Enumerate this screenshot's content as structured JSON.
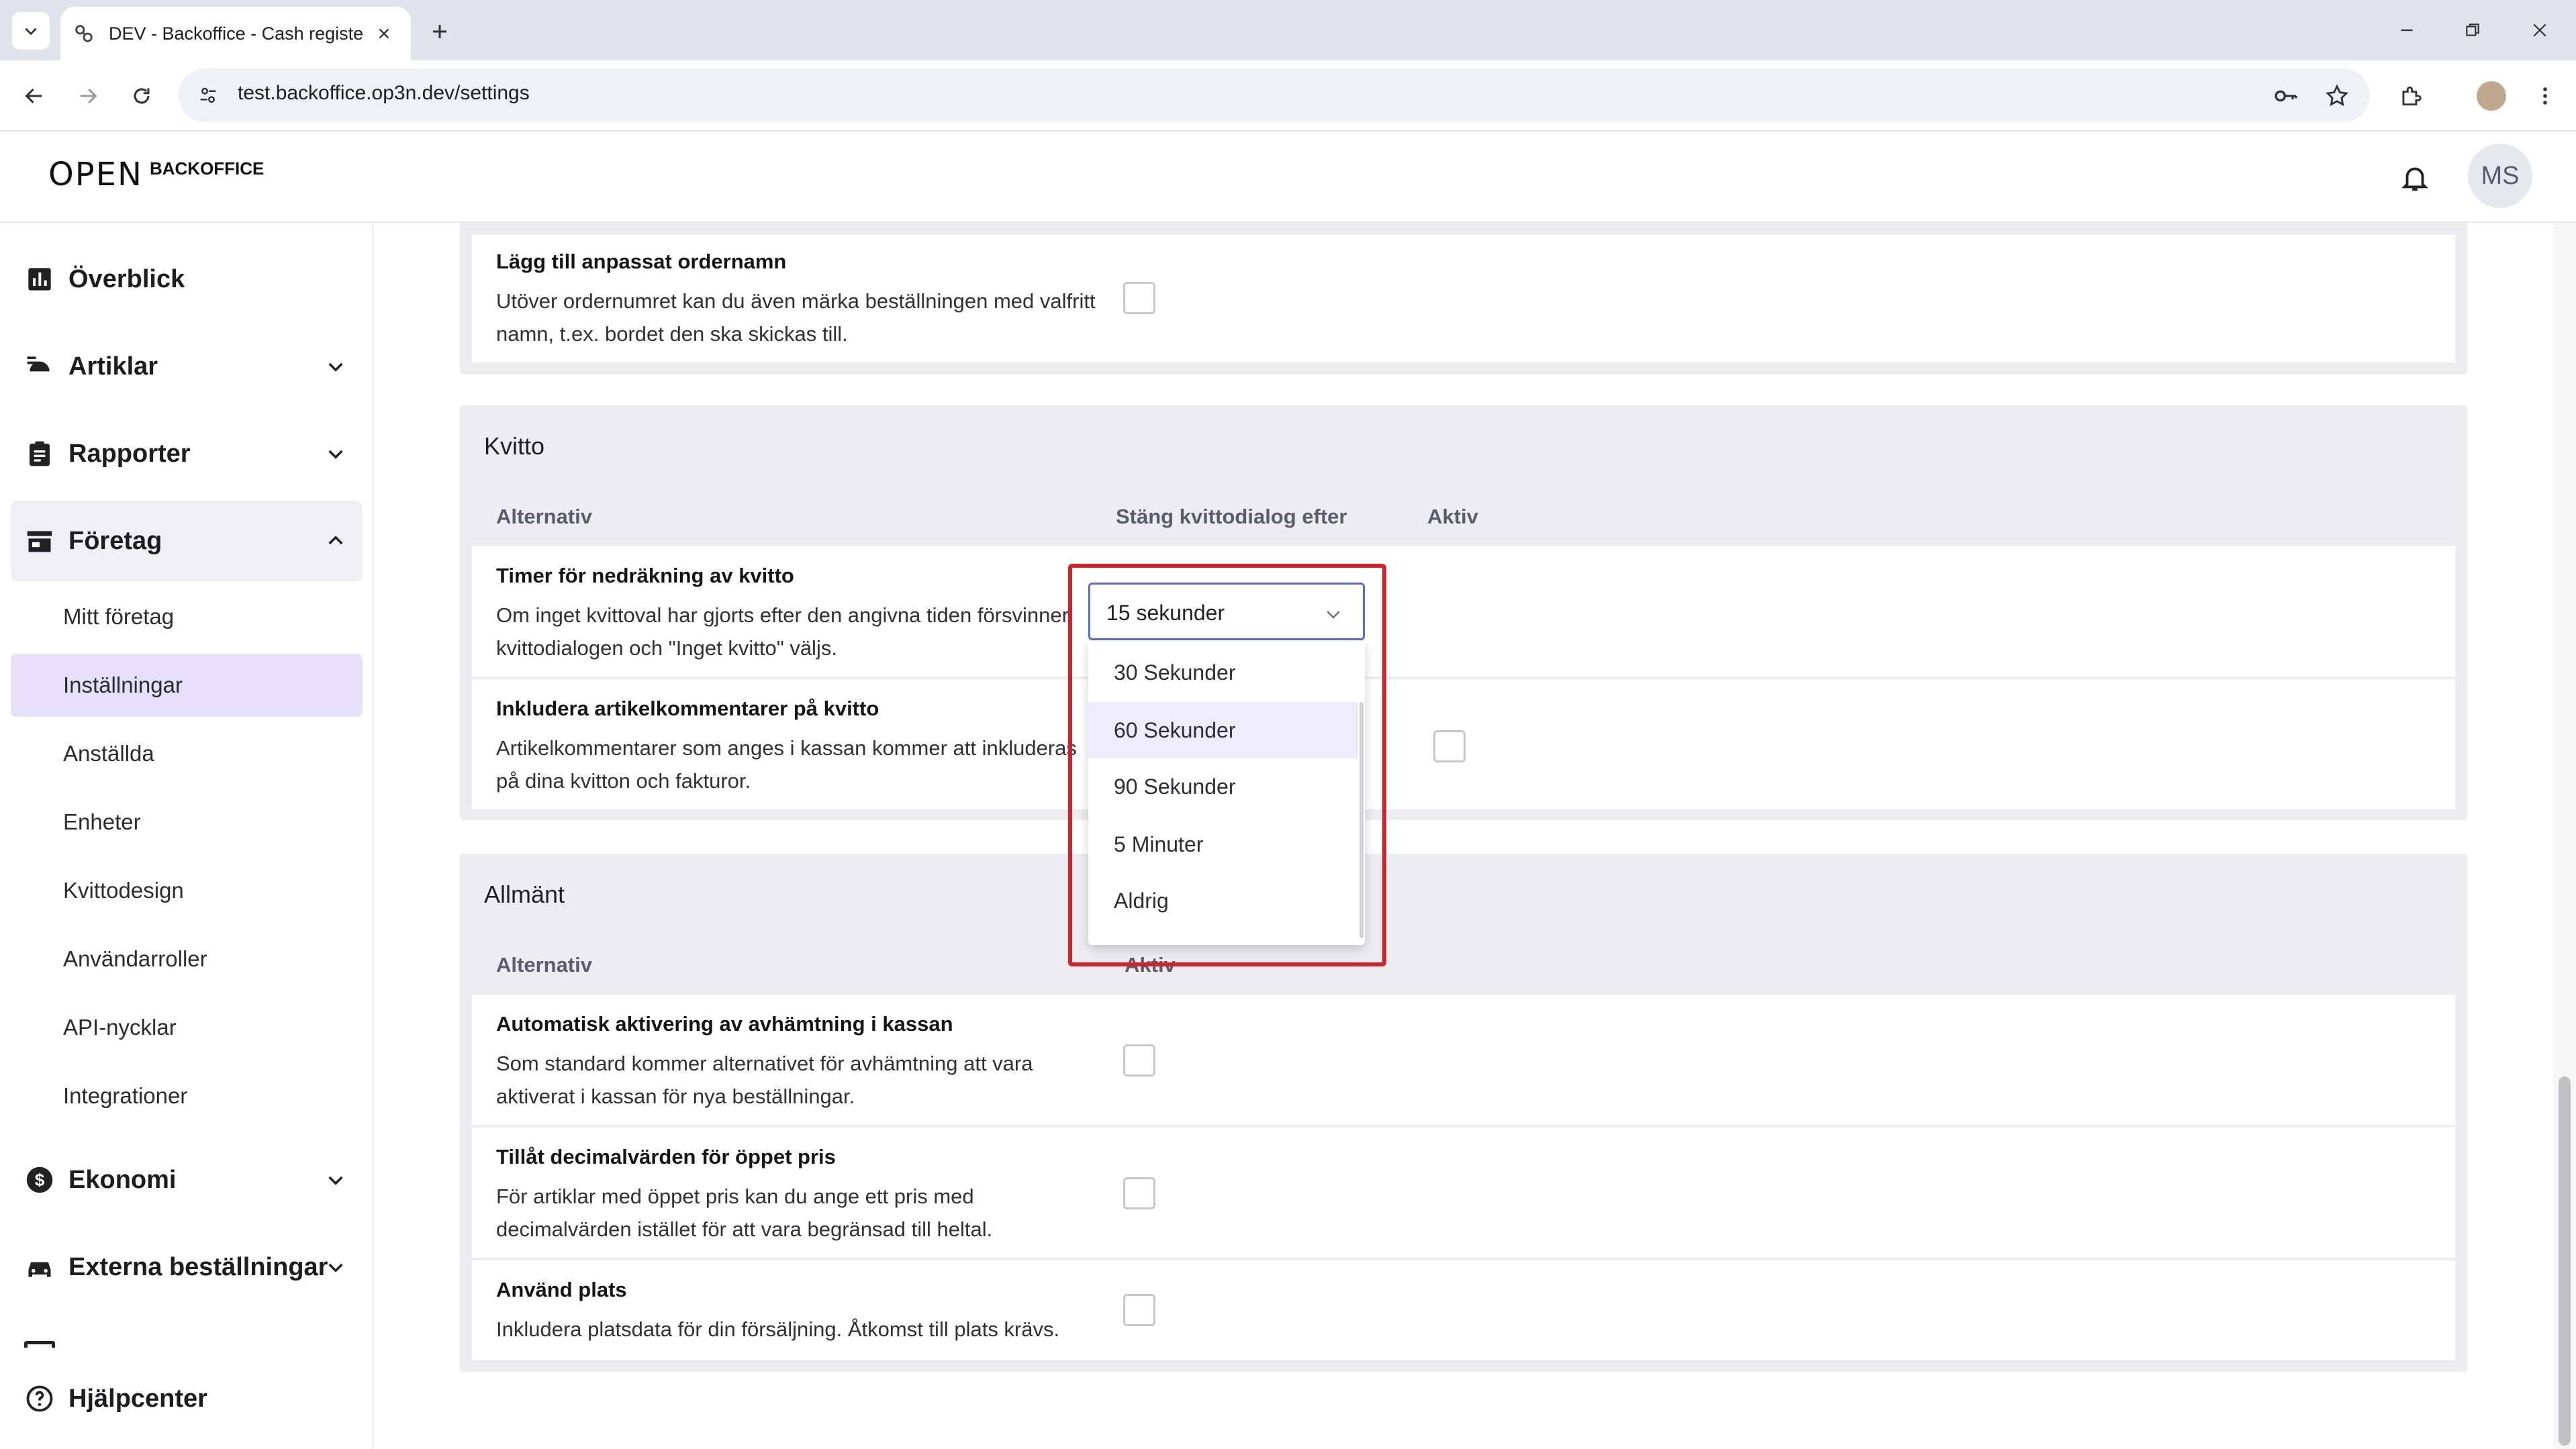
{
  "browser": {
    "tab_title": "DEV - Backoffice - Cash register",
    "url": "test.backoffice.op3n.dev/settings"
  },
  "header": {
    "logo_word": "OPEN",
    "logo_sub": "BACKOFFICE",
    "avatar_initials": "MS"
  },
  "sidebar": {
    "overview": "Överblick",
    "articles": "Artiklar",
    "reports": "Rapporter",
    "company": "Företag",
    "company_items": [
      "Mitt företag",
      "Inställningar",
      "Anställda",
      "Enheter",
      "Kvittodesign",
      "Användarroller",
      "API-nycklar",
      "Integrationer"
    ],
    "economy": "Ekonomi",
    "external_orders": "Externa beställningar",
    "help": "Hjälpcenter"
  },
  "sections": {
    "top_row": {
      "title": "Lägg till anpassat ordernamn",
      "desc": "Utöver ordernumret kan du även märka beställningen med valfritt namn, t.ex. bordet den ska skickas till."
    },
    "receipt": {
      "title": "Kvitto",
      "col_option": "Alternativ",
      "col_close": "Stäng kvittodialog efter",
      "col_active": "Aktiv",
      "rows": [
        {
          "title": "Timer för nedräkning av kvitto",
          "desc": "Om inget kvittoval har gjorts efter den angivna tiden försvinner kvittodialogen och \"Inget kvitto\" väljs."
        },
        {
          "title": "Inkludera artikelkommentarer på kvitto",
          "desc": "Artikelkommentarer som anges i kassan kommer att inkluderas på dina kvitton och fakturor."
        }
      ],
      "select_value": "15 sekunder",
      "options": [
        "30 Sekunder",
        "60 Sekunder",
        "90 Sekunder",
        "5 Minuter",
        "Aldrig"
      ],
      "hovered_option": "60 Sekunder"
    },
    "general": {
      "title": "Allmänt",
      "col_option": "Alternativ",
      "col_active": "Aktiv",
      "rows": [
        {
          "title": "Automatisk aktivering av avhämtning i kassan",
          "desc": "Som standard kommer alternativet för avhämtning att vara aktiverat i kassan för nya beställningar."
        },
        {
          "title": "Tillåt decimalvärden för öppet pris",
          "desc": "För artiklar med öppet pris kan du ange ett pris med decimalvärden istället för att vara begränsad till heltal."
        },
        {
          "title": "Använd plats",
          "desc": "Inkludera platsdata för din försäljning. Åtkomst till plats krävs."
        }
      ]
    }
  },
  "colors": {
    "accent": "#5b6ad0",
    "active_nav": "#e6e0fb",
    "highlight": "#d2222a",
    "card_bg": "#ededf1"
  }
}
